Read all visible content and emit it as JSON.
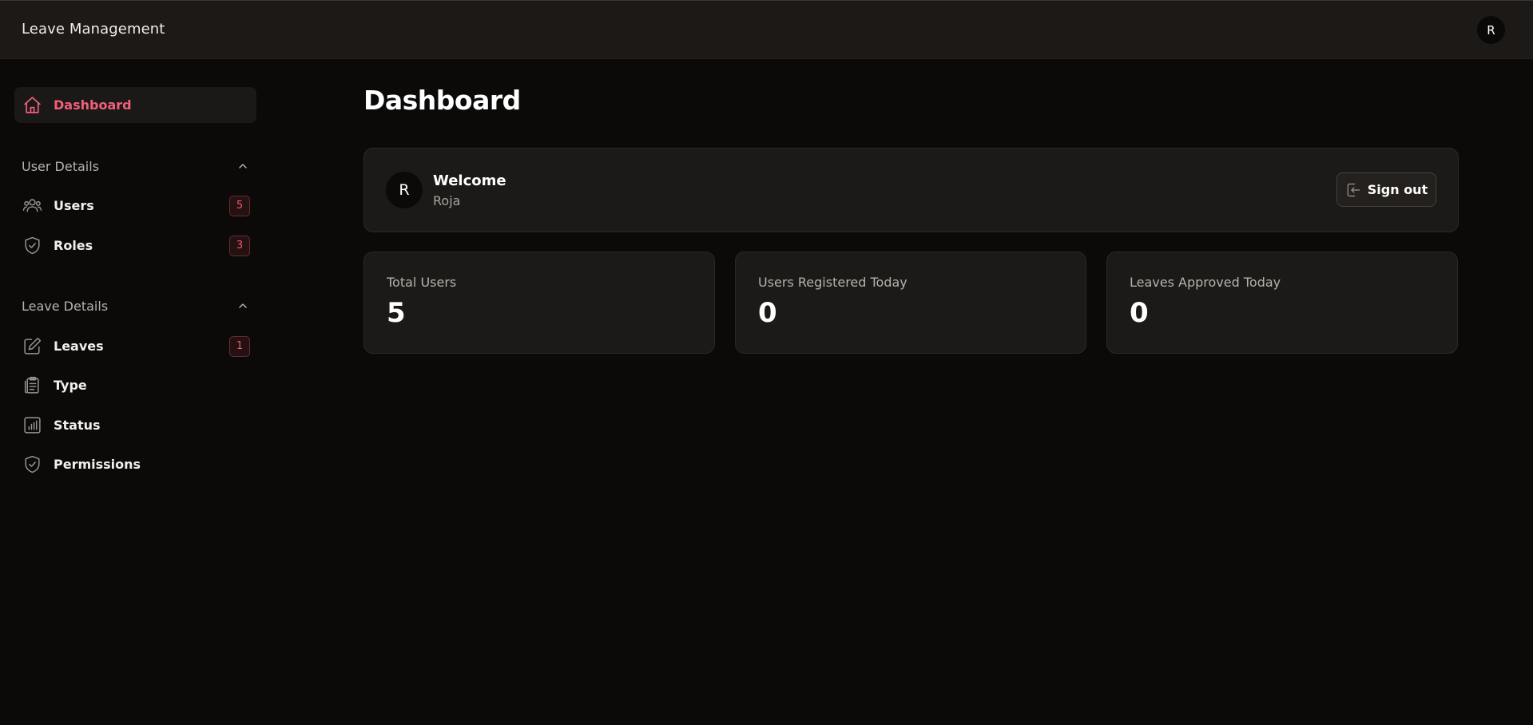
{
  "app": {
    "title": "Leave Management",
    "avatar_initial": "R"
  },
  "sidebar": {
    "dashboard": {
      "label": "Dashboard",
      "icon": "home-icon"
    },
    "sections": [
      {
        "title": "User Details",
        "items": [
          {
            "label": "Users",
            "badge": "5",
            "icon": "users-icon"
          },
          {
            "label": "Roles",
            "badge": "3",
            "icon": "shield-check-icon"
          }
        ]
      },
      {
        "title": "Leave Details",
        "items": [
          {
            "label": "Leaves",
            "badge": "1",
            "icon": "edit-icon"
          },
          {
            "label": "Type",
            "icon": "clipboard-icon"
          },
          {
            "label": "Status",
            "icon": "bar-chart-icon"
          },
          {
            "label": "Permissions",
            "icon": "shield-check-icon"
          }
        ]
      }
    ]
  },
  "main": {
    "title": "Dashboard",
    "welcome": {
      "avatar_initial": "R",
      "title": "Welcome",
      "name": "Roja",
      "signout_label": "Sign out"
    },
    "stats": [
      {
        "label": "Total Users",
        "value": "5"
      },
      {
        "label": "Users Registered Today",
        "value": "0"
      },
      {
        "label": "Leaves Approved Today",
        "value": "0"
      }
    ]
  },
  "colors": {
    "accent": "#f0607a",
    "background": "#0b0a09",
    "card": "#1c1a18",
    "topbar": "#1c1916"
  }
}
